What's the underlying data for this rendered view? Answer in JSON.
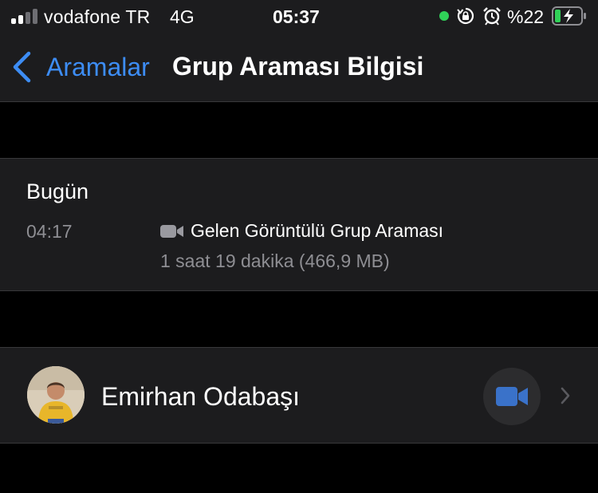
{
  "status_bar": {
    "carrier": "vodafone TR",
    "network": "4G",
    "time": "05:37",
    "battery_percent": "%22",
    "icons": [
      "signal-icon",
      "screen-record-dot-icon",
      "orientation-lock-icon",
      "alarm-icon",
      "battery-charging-icon"
    ]
  },
  "nav": {
    "back_label": "Aramalar",
    "title": "Grup Araması Bilgisi"
  },
  "call": {
    "date_header": "Bugün",
    "time": "04:17",
    "type": "Gelen Görüntülü Grup Araması",
    "detail": "1 saat 19 dakika (466,9 MB)",
    "type_icon": "video-camera-icon"
  },
  "participants": [
    {
      "name": "Emirhan Odabaşı",
      "action_icon": "video-call-icon"
    }
  ],
  "colors": {
    "background": "#000000",
    "surface": "#1c1c1e",
    "accent": "#3d8df5",
    "secondary_text": "#8e8e93",
    "video_button": "#2c2c2e",
    "video_icon": "#3a72c9",
    "green_dot": "#30d158"
  }
}
